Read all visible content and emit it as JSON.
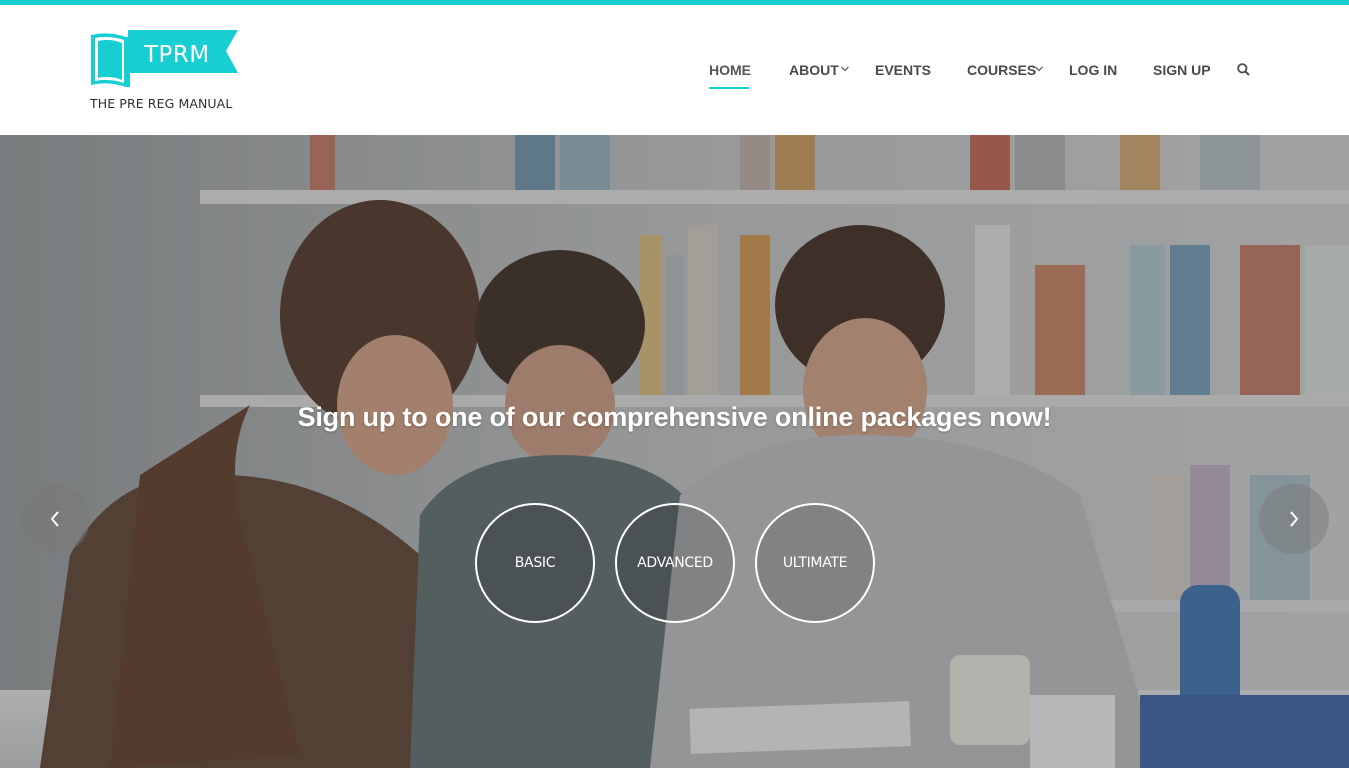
{
  "brand": {
    "logo_text": "TPRM",
    "tagline": "THE PRE REG MANUAL",
    "accent_color": "#17cfd3"
  },
  "nav": {
    "items": [
      {
        "label": "HOME",
        "active": true,
        "has_dropdown": false
      },
      {
        "label": "ABOUT",
        "active": false,
        "has_dropdown": true
      },
      {
        "label": "EVENTS",
        "active": false,
        "has_dropdown": false
      },
      {
        "label": "COURSES",
        "active": false,
        "has_dropdown": true
      },
      {
        "label": "LOG IN",
        "active": false,
        "has_dropdown": false
      },
      {
        "label": "SIGN UP",
        "active": false,
        "has_dropdown": false
      }
    ],
    "search_icon": "search-icon"
  },
  "hero": {
    "headline": "Sign up to one of our comprehensive online packages now!",
    "packages": [
      {
        "label": "BASIC"
      },
      {
        "label": "ADVANCED"
      },
      {
        "label": "ULTIMATE"
      }
    ],
    "prev_icon": "chevron-left-icon",
    "next_icon": "chevron-right-icon"
  }
}
